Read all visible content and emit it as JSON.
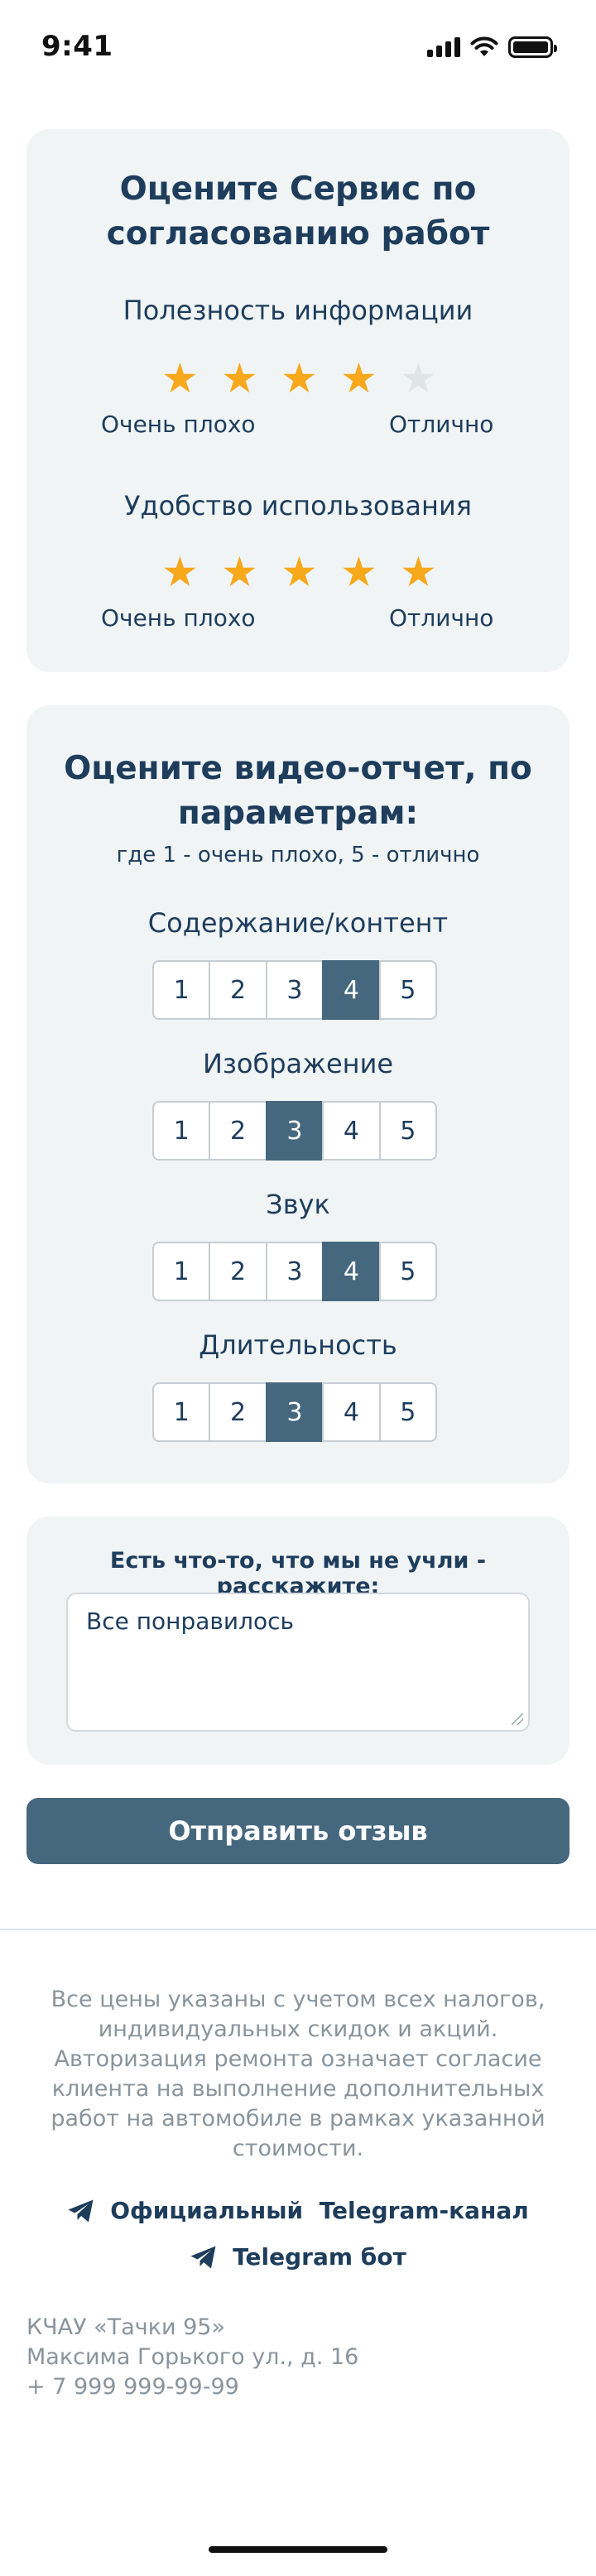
{
  "status_bar": {
    "time": "9:41"
  },
  "service_rating": {
    "title_line1": "Оцените Сервис по",
    "title_line2": "согласованию работ",
    "criteria": [
      {
        "label": "Полезность информации",
        "stars": 4,
        "max": 5,
        "low_label": "Очень плохо",
        "high_label": "Отлично"
      },
      {
        "label": "Удобство использования",
        "stars": 5,
        "max": 5,
        "low_label": "Очень плохо",
        "high_label": "Отлично"
      }
    ]
  },
  "video_rating": {
    "title_line1": "Оцените видео-отчет, по",
    "title_line2": "параметрам:",
    "subtitle": "где 1 - очень плохо, 5 - отлично",
    "scale": [
      "1",
      "2",
      "3",
      "4",
      "5"
    ],
    "params": [
      {
        "label": "Содержание/контент",
        "selected": 4
      },
      {
        "label": "Изображение",
        "selected": 3
      },
      {
        "label": "Звук",
        "selected": 4
      },
      {
        "label": "Длительность",
        "selected": 3
      }
    ]
  },
  "feedback": {
    "label": "Есть что-то, что мы не учли - расскажите:",
    "value": "Все понравилось"
  },
  "submit_label": "Отправить отзыв",
  "footer": {
    "disclaimer": "Все цены указаны с учетом всех налогов, индивидуальных скидок и акций. Авторизация ремонта означает согласие клиента на выполнение дополнительных работ на автомобиле в рамках указанной стоимости.",
    "telegram_channel": "Официальный  Telegram-канал",
    "telegram_bot": "Telegram бот",
    "company": "КЧАУ «Тачки 95»",
    "address": "Максима Горького ул., д. 16",
    "phone": "+ 7 999 999-99-99"
  },
  "colors": {
    "accent": "#45687e",
    "star": "#f7a81b",
    "star_off": "#dfe4e7",
    "card_bg": "#f0f4f5",
    "text": "#1e3d5c",
    "muted": "#8a949c"
  }
}
